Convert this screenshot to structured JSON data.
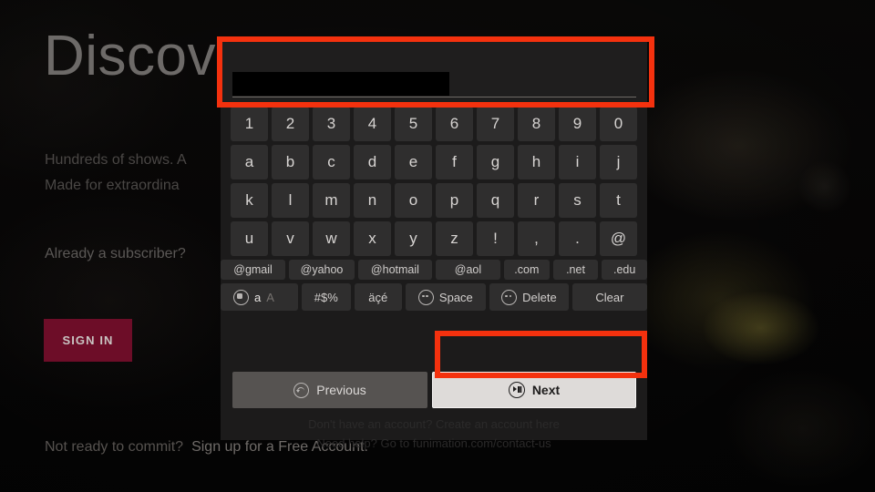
{
  "background": {
    "hero_title": "Discover",
    "hero_sub_line1": "Hundreds of shows. A",
    "hero_sub_line2": "Made for extraordina",
    "subscriber_prompt": "Already a subscriber?",
    "sign_in_label": "SIGN IN",
    "commit_prompt": "Not ready to commit?",
    "free_account_link": "Sign up for a Free Account."
  },
  "keyboard": {
    "input_value": "",
    "input_placeholder": "",
    "rows": [
      [
        "1",
        "2",
        "3",
        "4",
        "5",
        "6",
        "7",
        "8",
        "9",
        "0"
      ],
      [
        "a",
        "b",
        "c",
        "d",
        "e",
        "f",
        "g",
        "h",
        "i",
        "j"
      ],
      [
        "k",
        "l",
        "m",
        "n",
        "o",
        "p",
        "q",
        "r",
        "s",
        "t"
      ],
      [
        "u",
        "v",
        "w",
        "x",
        "y",
        "z",
        "!",
        ",",
        ".",
        "@"
      ]
    ],
    "domains": [
      "@gmail",
      "@yahoo",
      "@hotmail",
      "@aol",
      ".com",
      ".net",
      ".edu"
    ],
    "functions": {
      "shift_lower": "a",
      "shift_upper": "A",
      "symbols": "#$%",
      "accents": "äçé",
      "space": "Space",
      "delete": "Delete",
      "clear": "Clear"
    },
    "nav": {
      "previous": "Previous",
      "next": "Next"
    },
    "footer_line1": "Don't have an account? Create an account here",
    "footer_line2": "Need help? Go to funimation.com/contact-us"
  },
  "annotations": {
    "highlight_color": "#f4310e",
    "boxes": [
      "text-input-field",
      "next-button"
    ]
  },
  "icons": {
    "shift": "shift-circle-icon",
    "space": "space-circle-icon",
    "delete": "delete-circle-icon",
    "previous": "back-arrow-circle-icon",
    "next": "play-pause-circle-icon"
  }
}
